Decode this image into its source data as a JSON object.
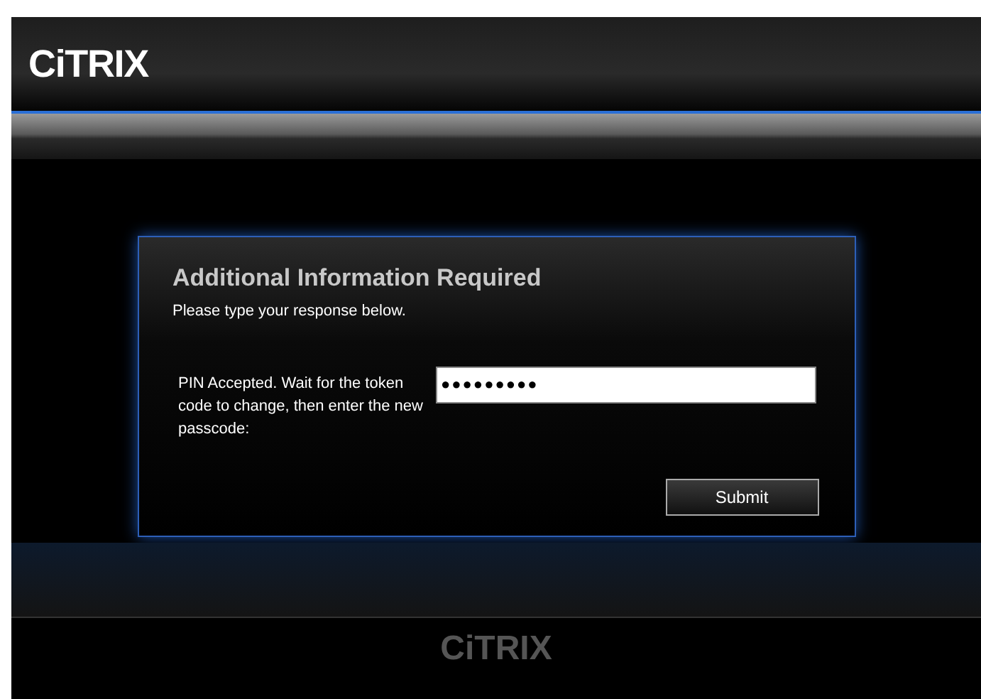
{
  "header": {
    "logo": "CiTRIX"
  },
  "dialog": {
    "title": "Additional Information Required",
    "subtitle": "Please type your response below.",
    "prompt": "PIN Accepted. Wait for the token code to change, then enter the new passcode:",
    "passcode": "●●●●●●●●●",
    "submit": "Submit"
  },
  "footer": {
    "logo": "CiTRIX"
  }
}
